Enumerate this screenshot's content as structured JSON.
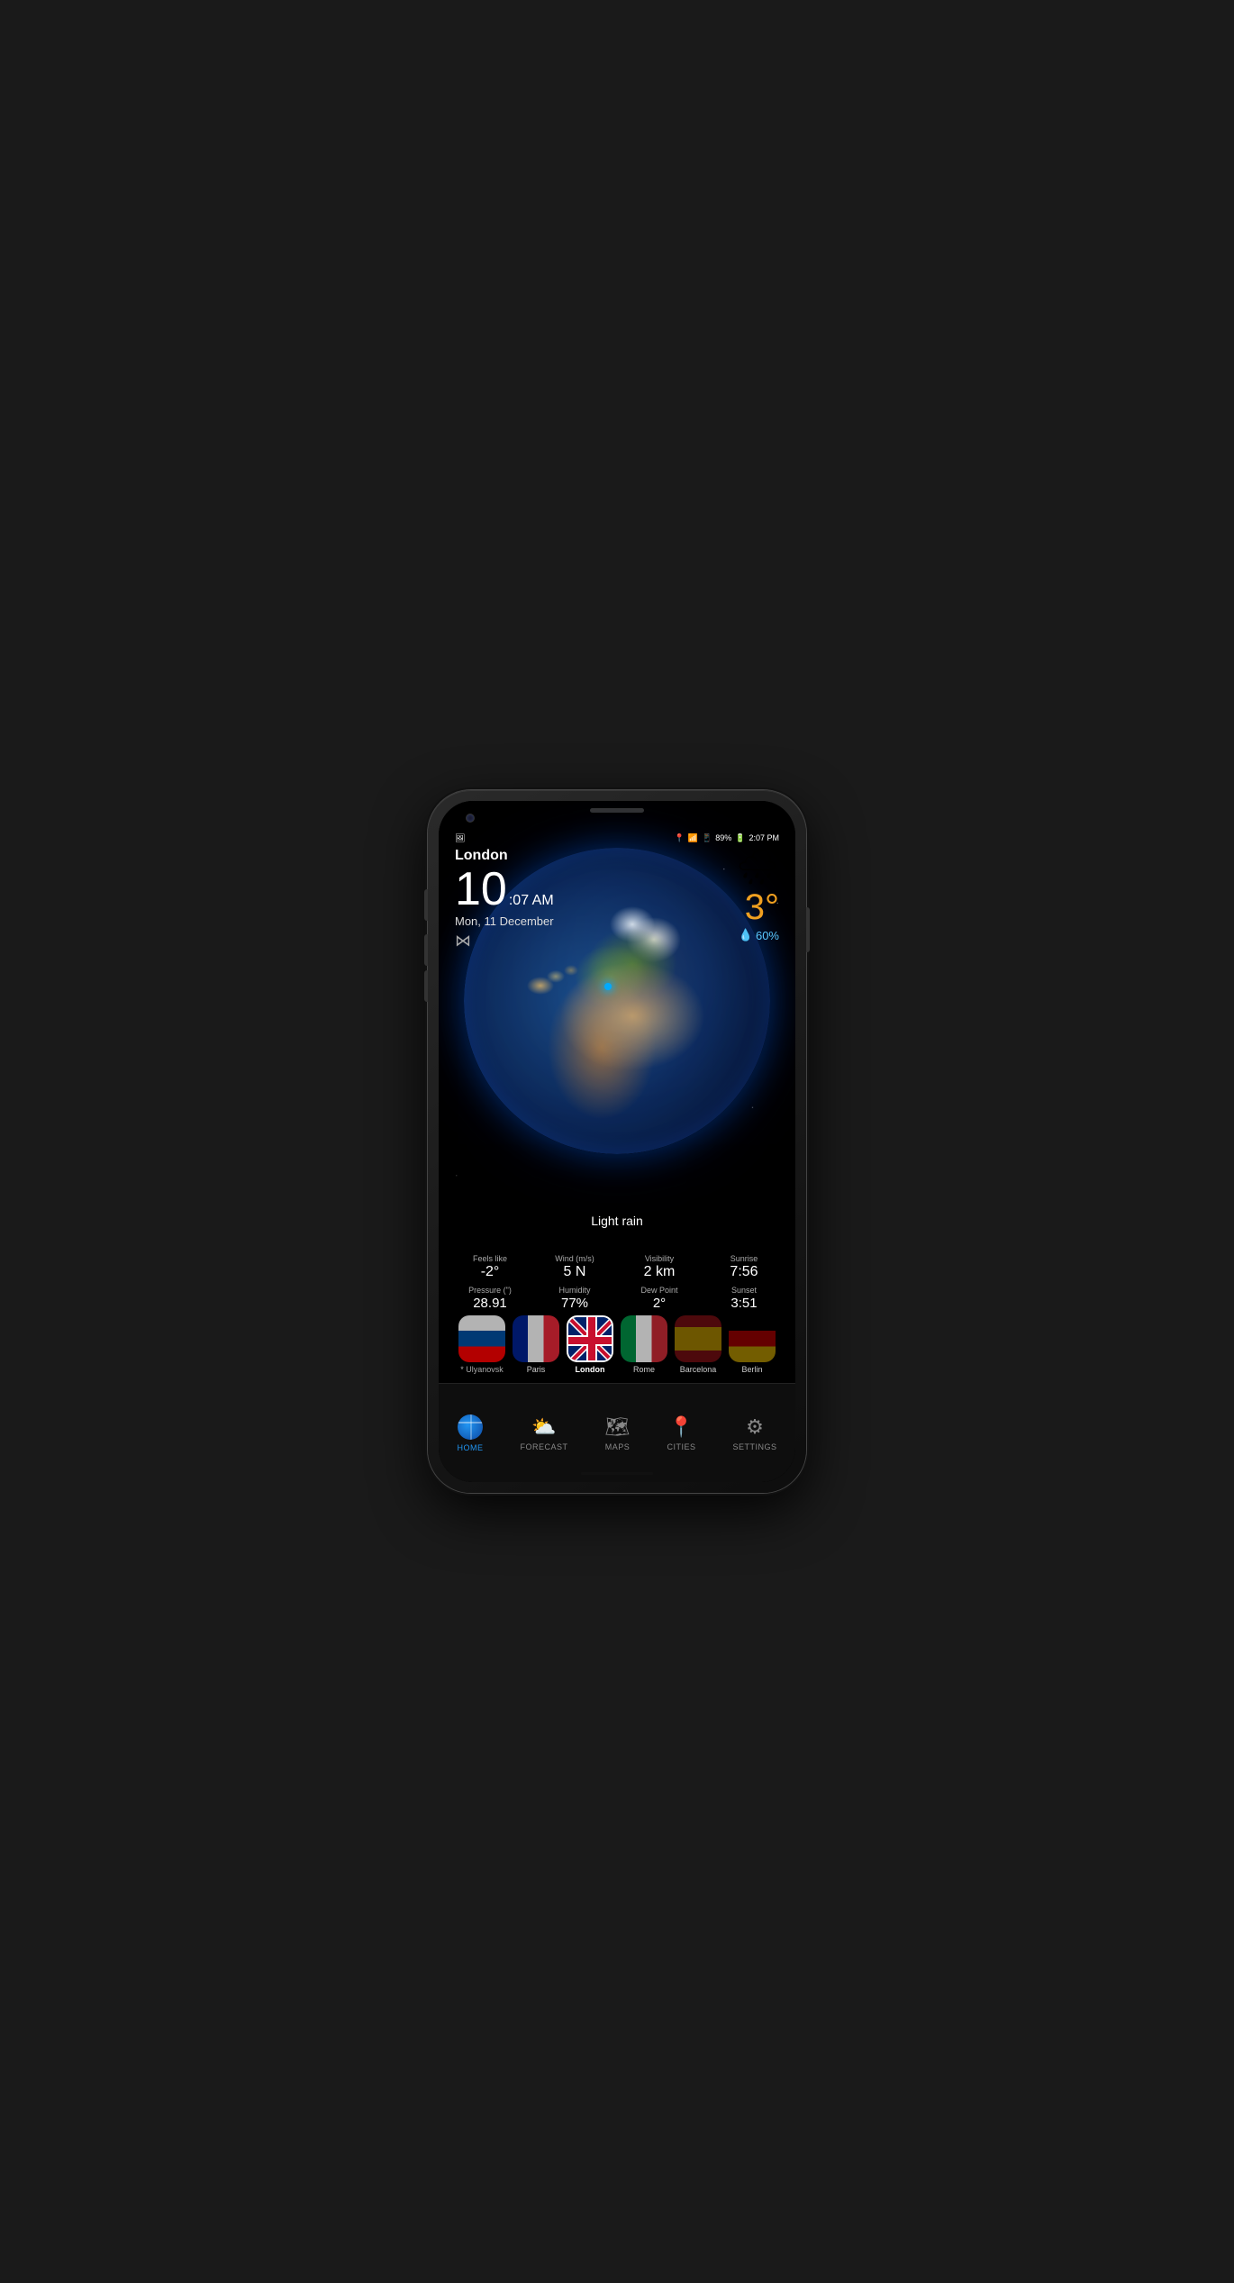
{
  "status_bar": {
    "location_icon": "📍",
    "wifi_signal": "wifi",
    "cell_signal": "signal",
    "battery": "89%",
    "time": "2:07 PM"
  },
  "weather": {
    "city": "London",
    "time_big": "10",
    "time_small": ":07 AM",
    "date": "Mon, 11 December",
    "temperature": "3°",
    "precipitation": "60%",
    "condition": "Light rain",
    "feels_like_label": "Feels like",
    "feels_like": "-2°",
    "wind_label": "Wind (m/s)",
    "wind": "5 N",
    "visibility_label": "Visibility",
    "visibility": "2 km",
    "sunrise_label": "Sunrise",
    "sunrise": "7:56",
    "pressure_label": "Pressure (\")",
    "pressure": "28.91",
    "humidity_label": "Humidity",
    "humidity": "77%",
    "dew_point_label": "Dew Point",
    "dew_point": "2°",
    "sunset_label": "Sunset",
    "sunset": "3:51"
  },
  "cities": [
    {
      "name": "* Ulyanovsk",
      "flag": "russia",
      "active": false
    },
    {
      "name": "Paris",
      "flag": "france",
      "active": false
    },
    {
      "name": "London",
      "flag": "uk",
      "active": true
    },
    {
      "name": "Rome",
      "flag": "italy",
      "active": false
    },
    {
      "name": "Barcelona",
      "flag": "spain",
      "active": false
    },
    {
      "name": "Berlin",
      "flag": "berlin",
      "active": false
    }
  ],
  "nav": [
    {
      "id": "home",
      "label": "HOME",
      "active": true
    },
    {
      "id": "forecast",
      "label": "FORECAST",
      "active": false
    },
    {
      "id": "maps",
      "label": "MAPS",
      "active": false
    },
    {
      "id": "cities",
      "label": "CITIES",
      "active": false
    },
    {
      "id": "settings",
      "label": "SETTINGS",
      "active": false
    }
  ]
}
